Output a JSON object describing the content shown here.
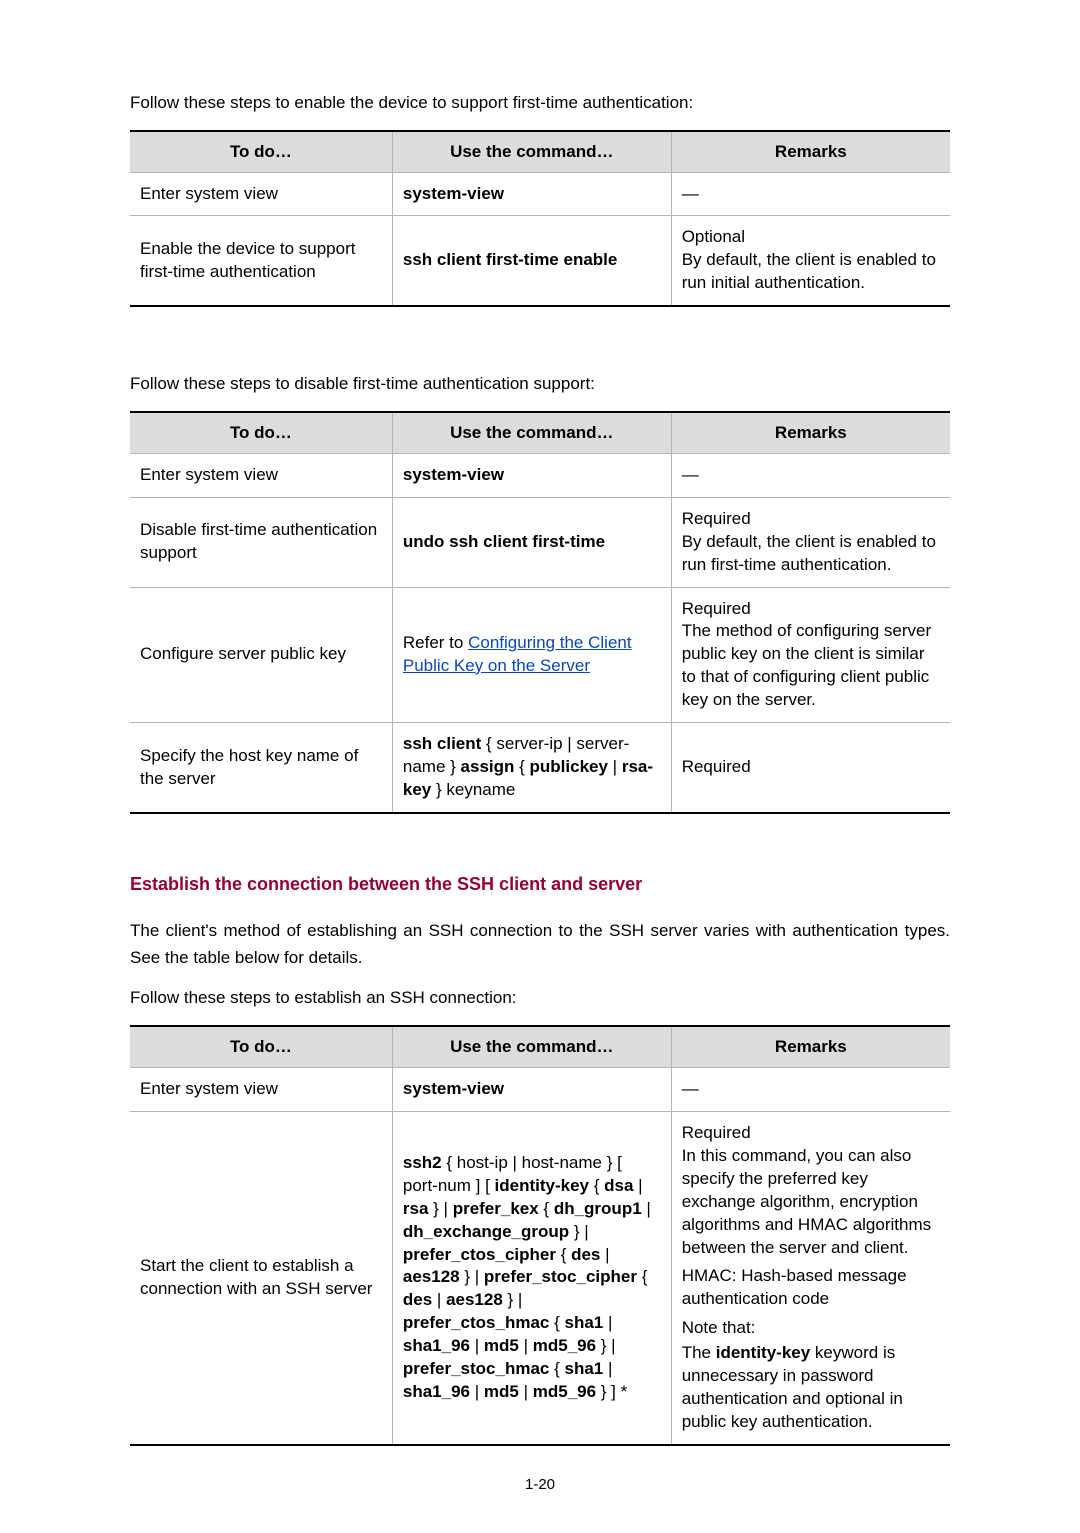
{
  "headers": {
    "todo": "To do…",
    "cmd": "Use the command…",
    "remarks": "Remarks"
  },
  "t1": {
    "intro": "Follow these steps to enable the device to support first-time authentication:",
    "r1": {
      "todo": "Enter system view",
      "cmd": "system-view",
      "rem": "—"
    },
    "r2": {
      "todo": "Enable the device to support first-time authentication",
      "cmd": "ssh client first-time enable",
      "rem_a": "Optional",
      "rem_b": "By default, the client is enabled to run initial authentication."
    }
  },
  "t2": {
    "intro": "Follow these steps to disable first-time authentication support:",
    "r1": {
      "todo": "Enter system view",
      "cmd": "system-view",
      "rem": "—"
    },
    "r2": {
      "todo": "Disable first-time authentication support",
      "cmd": "undo ssh client first-time",
      "rem_a": "Required",
      "rem_b": "By default, the client is enabled to run first-time authentication."
    },
    "r3": {
      "todo": "Configure server public key",
      "cmd_a": "Refer to ",
      "cmd_link": "Configuring the Client Public Key on the Server",
      "rem_a": "Required",
      "rem_b": "The method of configuring server public key on the client is similar to that of configuring client public key on the server."
    },
    "r4": {
      "todo": "Specify the host key name of the server",
      "c1": "ssh client",
      "c2": " { server-ip | server-name } ",
      "c3": "assign",
      "c4": " { ",
      "c5": "publickey",
      "c6": " | ",
      "c7": "rsa-key",
      "c8": " } keyname",
      "rem": "Required"
    }
  },
  "sec_title": "Establish the connection between the SSH client and server",
  "t3": {
    "intro_a": "The client's method of establishing an SSH connection to the SSH server varies with authentication types. See the table below for details.",
    "intro_b": "Follow these steps to establish an SSH connection:",
    "r1": {
      "todo": "Enter system view",
      "cmd": "system-view",
      "rem": "—"
    },
    "r2": {
      "todo": "Start the client to establish a connection with an SSH server",
      "s1": "ssh2",
      "s2": " { host-ip | host-name } [ port-num ] [ ",
      "s3": "identity-key",
      "s4": " { ",
      "s5": "dsa",
      "s6": " | ",
      "s7": "rsa",
      "s8": " } | ",
      "s9": "prefer_kex",
      "s10": " { ",
      "s11": "dh_group1",
      "s12": " | ",
      "s13": "dh_exchange_group",
      "s14": " } | ",
      "s15": "prefer_ctos_cipher",
      "s16": " { ",
      "s17": "des",
      "s18": " | ",
      "s19": "aes128",
      "s20": " } | ",
      "s21": "prefer_stoc_cipher",
      "s22": " { ",
      "s23": "des",
      "s24": " | ",
      "s25": "aes128",
      "s26": " } | ",
      "s27": "prefer_ctos_hmac",
      "s28": " { ",
      "s29": "sha1",
      "s30": " | ",
      "s31": "sha1_96",
      "s32": " | ",
      "s33": "md5",
      "s34": " | ",
      "s35": "md5_96",
      "s36": " } | ",
      "s37": "prefer_stoc_hmac",
      "s38": " { ",
      "s39": "sha1",
      "s40": " | ",
      "s41": "sha1_96",
      "s42": " | ",
      "s43": "md5",
      "s44": " | ",
      "s45": "md5_96",
      "s46": " } ] *",
      "ra": "Required",
      "rb": "In this command, you can also specify the preferred key exchange algorithm, encryption algorithms and HMAC algorithms between the server and client.",
      "rc": "HMAC: Hash-based message authentication code",
      "rd": "Note that:",
      "re1": "The ",
      "re2": "identity-key",
      "re3": " keyword is unnecessary in password authentication and optional in public key authentication."
    }
  },
  "page_number": "1-20"
}
